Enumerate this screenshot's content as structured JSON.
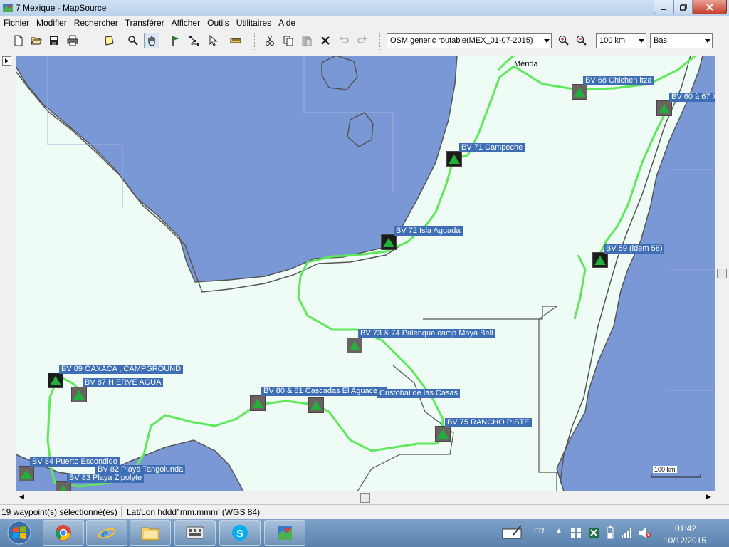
{
  "window": {
    "title": "7 Mexique - MapSource"
  },
  "menu": [
    "Fichier",
    "Modifier",
    "Rechercher",
    "Transférer",
    "Afficher",
    "Outils",
    "Utilitaires",
    "Aide"
  ],
  "toolbar": {
    "map_product": "OSM generic routable(MEX_01-07-2015)",
    "zoom_scale": "100 km",
    "detail_level": "Bas"
  },
  "map": {
    "city": "Mérida",
    "scale_label": "100 km",
    "waypoints": [
      "BV 68 Chichen itza",
      "BV 60 à 67 X",
      "BV 71 Campeche",
      "BV 72 Isla Aguada",
      "BV 59 (idem 58)",
      "BV 73 & 74 Palenque camp Maya Bell",
      "BV 89 OAXACA , CAMPGROUND",
      "BV 87 HIERVE AGUA",
      "BV 80 & 81 Cascadas El Aguacero",
      "Cristobal de las Casas",
      "BV 75 RANCHO PISTE",
      "BV 84 Puerto Escondido",
      "BV 82 Playa Tangolunda",
      "BV 83 Playa Zipolyte"
    ]
  },
  "status": {
    "selection": "19 waypoint(s) sélectionné(es)",
    "coord_format": "Lat/Lon hddd°mm.mmm' (WGS 84)"
  },
  "taskbar": {
    "language": "FR",
    "time": "01:42",
    "date": "10/12/2015"
  }
}
